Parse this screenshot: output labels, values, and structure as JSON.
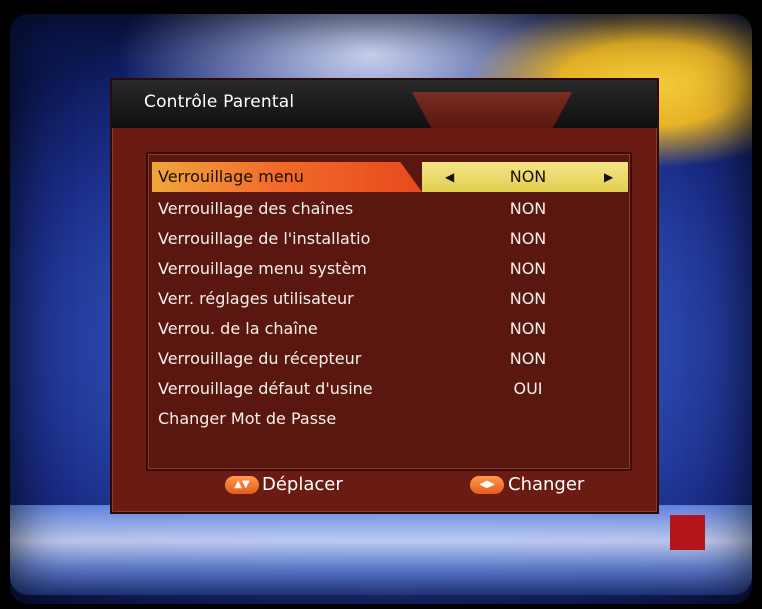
{
  "screen": {
    "title": "Contrôle Parental",
    "colors": {
      "panel_bg": "#6a1c14",
      "selected_left": "#f26b2b",
      "selected_right": "#e2cf4e",
      "text": "#f4f1ea"
    }
  },
  "menu": {
    "items": [
      {
        "label": "Verrouillage menu",
        "value": "NON",
        "selected": true
      },
      {
        "label": "Verrouillage des chaînes",
        "value": "NON",
        "selected": false
      },
      {
        "label": "Verrouillage de l'installatio",
        "value": "NON",
        "selected": false
      },
      {
        "label": "Verrouillage menu systèm",
        "value": "NON",
        "selected": false
      },
      {
        "label": "Verr. réglages utilisateur",
        "value": "NON",
        "selected": false
      },
      {
        "label": "Verrou. de la chaîne",
        "value": "NON",
        "selected": false
      },
      {
        "label": "Verrouillage du récepteur",
        "value": "NON",
        "selected": false
      },
      {
        "label": "Verrouillage défaut d'usine",
        "value": "OUI",
        "selected": false
      },
      {
        "label": "Changer Mot de Passe",
        "value": "",
        "selected": false
      }
    ],
    "value_arrows": {
      "left_icon": "arrow-left-icon",
      "right_icon": "arrow-right-icon",
      "left_glyph": "◀",
      "right_glyph": "▶"
    }
  },
  "footer": {
    "move": {
      "label": "Déplacer",
      "icon": "up-down-button-icon",
      "icon_text": "▲▼"
    },
    "change": {
      "label": "Changer",
      "icon": "left-right-button-icon",
      "icon_text": "◀▶"
    }
  }
}
